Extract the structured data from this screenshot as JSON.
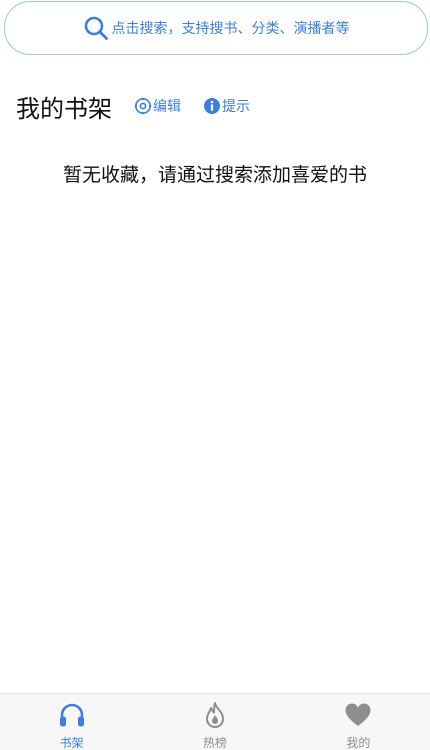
{
  "search": {
    "placeholder": "点击搜索，支持搜书、分类、演播者等",
    "icon": "search-icon"
  },
  "shelf": {
    "title": "我的书架",
    "actions": {
      "edit": {
        "label": "编辑",
        "icon": "gear-icon"
      },
      "tip": {
        "label": "提示",
        "icon": "info-icon"
      }
    },
    "empty_message": "暂无收藏，请通过搜索添加喜爱的书"
  },
  "tabbar": {
    "active_index": 0,
    "tabs": [
      {
        "label": "书架",
        "icon": "headphones-icon"
      },
      {
        "label": "热榜",
        "icon": "flame-icon"
      },
      {
        "label": "我的",
        "icon": "heart-icon"
      }
    ]
  },
  "colors": {
    "accent": "#3b7fe0",
    "border": "#9ec3ef",
    "inactive": "#8e8e8e",
    "tabbar_bg": "#f7f7f7"
  }
}
